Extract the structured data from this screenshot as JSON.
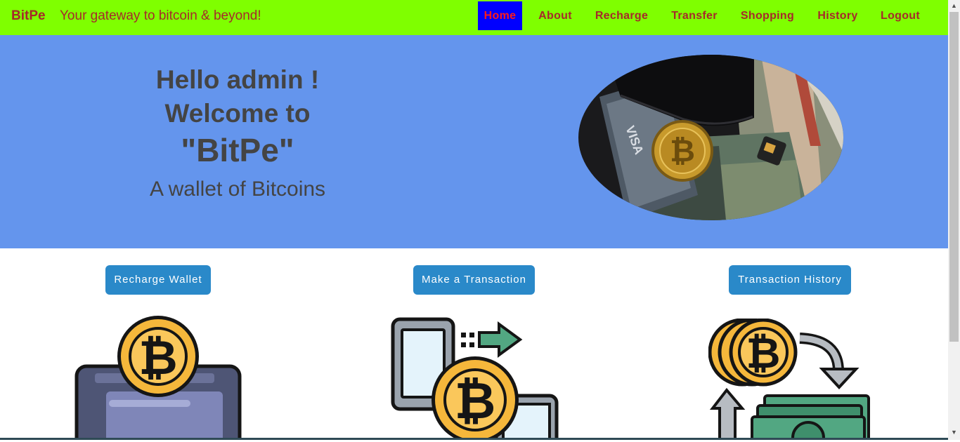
{
  "navbar": {
    "brand": "BitPe",
    "tagline": "Your gateway to bitcoin & beyond!",
    "items": [
      {
        "label": "Home",
        "active": true
      },
      {
        "label": "About"
      },
      {
        "label": "Recharge"
      },
      {
        "label": "Transfer"
      },
      {
        "label": "Shopping"
      },
      {
        "label": "History"
      },
      {
        "label": "Logout"
      }
    ]
  },
  "hero": {
    "line1": "Hello admin !",
    "line2": "Welcome to",
    "line3": "\"BitPe\"",
    "line4": "A wallet of Bitcoins"
  },
  "actions": {
    "recharge": "Recharge Wallet",
    "transaction": "Make a Transaction",
    "history": "Transaction History"
  },
  "colors": {
    "navbar_bg": "#7fff00",
    "nav_text": "#a52a2a",
    "active_bg": "#0000ff",
    "hero_bg": "#6495ed",
    "button_bg": "#2a89c9"
  }
}
